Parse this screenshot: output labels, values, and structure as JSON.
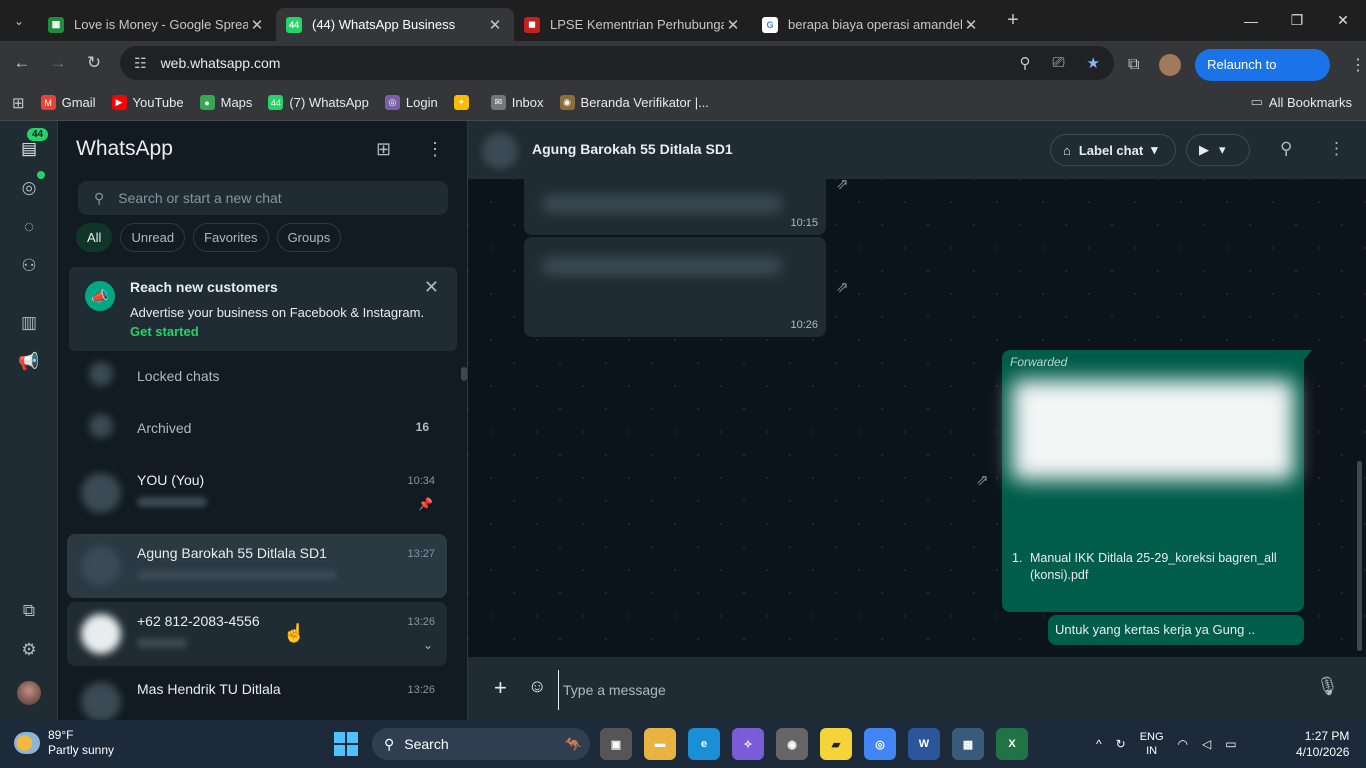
{
  "browser": {
    "tabs": [
      {
        "title": "Love is Money - Google Spread",
        "favicon": "sheets-icon",
        "color": "#1e8e3e"
      },
      {
        "title": "(44) WhatsApp Business",
        "favicon": "whatsapp-icon",
        "color": "#25d366",
        "favtext": "44"
      },
      {
        "title": "LPSE Kementrian Perhubungan",
        "favicon": "lpse-icon",
        "color": "#c5221f"
      },
      {
        "title": "berapa biaya operasi amandel -",
        "favicon": "google-icon",
        "color": "#4285f4"
      }
    ],
    "url": "web.whatsapp.com",
    "relaunch_label": "Relaunch to update",
    "bookmarks": [
      {
        "label": "Gmail",
        "color": "#ea4335"
      },
      {
        "label": "YouTube",
        "color": "#ff0000"
      },
      {
        "label": "Maps",
        "color": "#34a853"
      },
      {
        "label": "(7) WhatsApp",
        "color": "#25d366",
        "favtext": "44"
      },
      {
        "label": "Login",
        "color": "#7b5ea7"
      },
      {
        "label": "",
        "color": "#fbbc04"
      },
      {
        "label": "Inbox",
        "color": "#777777"
      },
      {
        "label": "Beranda Verifikator |...",
        "color": "#8a6d3b"
      }
    ],
    "all_bookmarks": "All Bookmarks"
  },
  "rail": {
    "badge": "44"
  },
  "sidebar": {
    "title": "WhatsApp",
    "search_placeholder": "Search or start a new chat",
    "filters": [
      "All",
      "Unread",
      "Favorites",
      "Groups"
    ],
    "promo": {
      "title": "Reach new customers",
      "text": "Advertise your business on Facebook & Instagram.",
      "cta": "Get started"
    },
    "locked": "Locked chats",
    "archived": "Archived",
    "archived_count": "16",
    "chats": [
      {
        "name": "YOU (You)",
        "time": "10:34"
      },
      {
        "name": "Agung Barokah 55 Ditlala SD1",
        "time": "13:27"
      },
      {
        "name": "+62 812-2083-4556",
        "time": "13:26"
      },
      {
        "name": "Mas Hendrik TU Ditlala",
        "time": "13:26"
      }
    ]
  },
  "chat": {
    "name": "Agung Barokah 55 Ditlala SD1",
    "label_chat": "Label chat",
    "messages_in": [
      {
        "time": "10:15"
      },
      {
        "time": "10:26"
      }
    ],
    "forwarded": "Forwarded",
    "doc_number": "1.",
    "doc_text": "Manual IKK Ditlala 25-29_koreksi bagren_all (konsi).pdf",
    "reply": "Untuk yang kertas kerja ya Gung ..",
    "composer_placeholder": "Type a message"
  },
  "taskbar": {
    "temp": "89°F",
    "weather": "Partly sunny",
    "search": "Search",
    "lang1": "ENG",
    "lang2": "IN",
    "time": "1:27 PM",
    "date": "4/10/2026"
  }
}
